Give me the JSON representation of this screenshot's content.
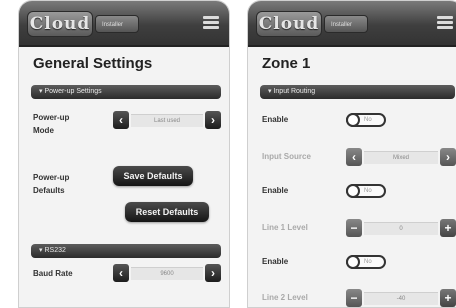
{
  "left_screen": {
    "logo": "Cloud",
    "tab_label": "Installer",
    "title": "General Settings",
    "section1": "Power-up Settings",
    "powerup_mode_label": "Power-up Mode",
    "powerup_mode_value": "Last used",
    "powerup_defaults_label": "Power-up Defaults",
    "save_defaults": "Save Defaults",
    "reset_defaults": "Reset Defaults",
    "section2": "RS232",
    "baud_rate_label": "Baud Rate",
    "baud_rate_value": "9600"
  },
  "right_screen": {
    "logo": "Cloud",
    "tab_label": "Installer",
    "title": "Zone 1",
    "section1": "Input Routing",
    "enable_label": "Enable",
    "toggle_text": "No",
    "input_source_label": "Input Source",
    "input_source_value": "Mixed",
    "enable2_label": "Enable",
    "line1_label": "Line 1 Level",
    "line1_value": "0",
    "enable3_label": "Enable",
    "line2_label": "Line 2 Level",
    "line2_value": "-40"
  },
  "icons": {
    "left_arrow": "chevron-left-icon",
    "right_arrow": "chevron-right-icon",
    "minus": "minus-icon",
    "plus": "plus-icon",
    "menu": "hamburger-menu-icon"
  }
}
